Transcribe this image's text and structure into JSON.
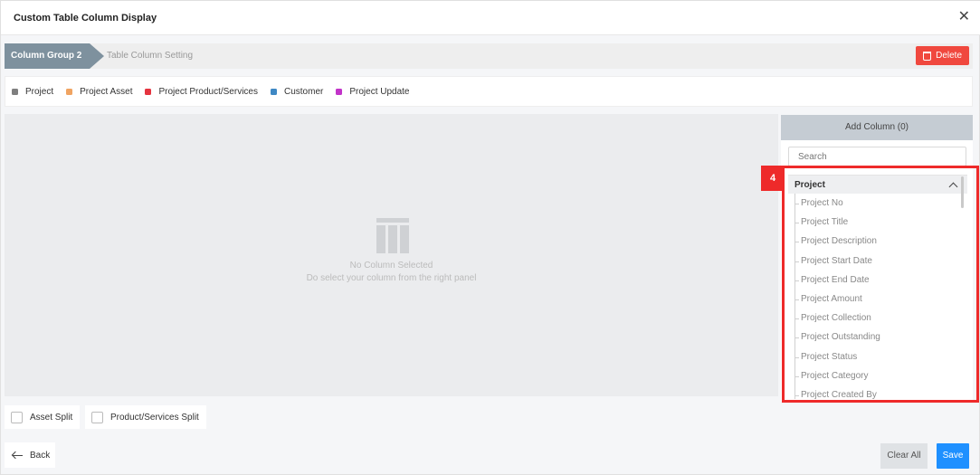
{
  "modal": {
    "title": "Custom Table Column Display",
    "close_icon": "close-icon"
  },
  "breadcrumb": {
    "active": "Column Group 2",
    "next": "Table Column Setting"
  },
  "delete_button": {
    "label": "Delete",
    "icon": "trash-icon",
    "color": "#f0483e"
  },
  "legend": [
    {
      "label": "Project",
      "color": "#7f7f7f"
    },
    {
      "label": "Project Asset",
      "color": "#f0a462"
    },
    {
      "label": "Project Product/Services",
      "color": "#e5343f"
    },
    {
      "label": "Customer",
      "color": "#3e88c4"
    },
    {
      "label": "Project Update",
      "color": "#c233c9"
    }
  ],
  "empty_state": {
    "icon": "table-icon",
    "title": "No Column Selected",
    "subtitle": "Do select your column from the right panel"
  },
  "panel": {
    "add_column_label": "Add Column (0)",
    "search_placeholder": "Search",
    "group": {
      "label": "Project",
      "items": [
        "Project No",
        "Project Title",
        "Project Description",
        "Project Start Date",
        "Project End Date",
        "Project Amount",
        "Project Collection",
        "Project Outstanding",
        "Project Status",
        "Project Category",
        "Project Created By"
      ]
    }
  },
  "annotation": {
    "step": "4",
    "color": "#ee2a2a"
  },
  "checkboxes": {
    "asset_split": "Asset Split",
    "product_split": "Product/Services Split"
  },
  "footer": {
    "back_label": "Back",
    "clear_label": "Clear All",
    "save_label": "Save",
    "save_color": "#1e90ff"
  }
}
